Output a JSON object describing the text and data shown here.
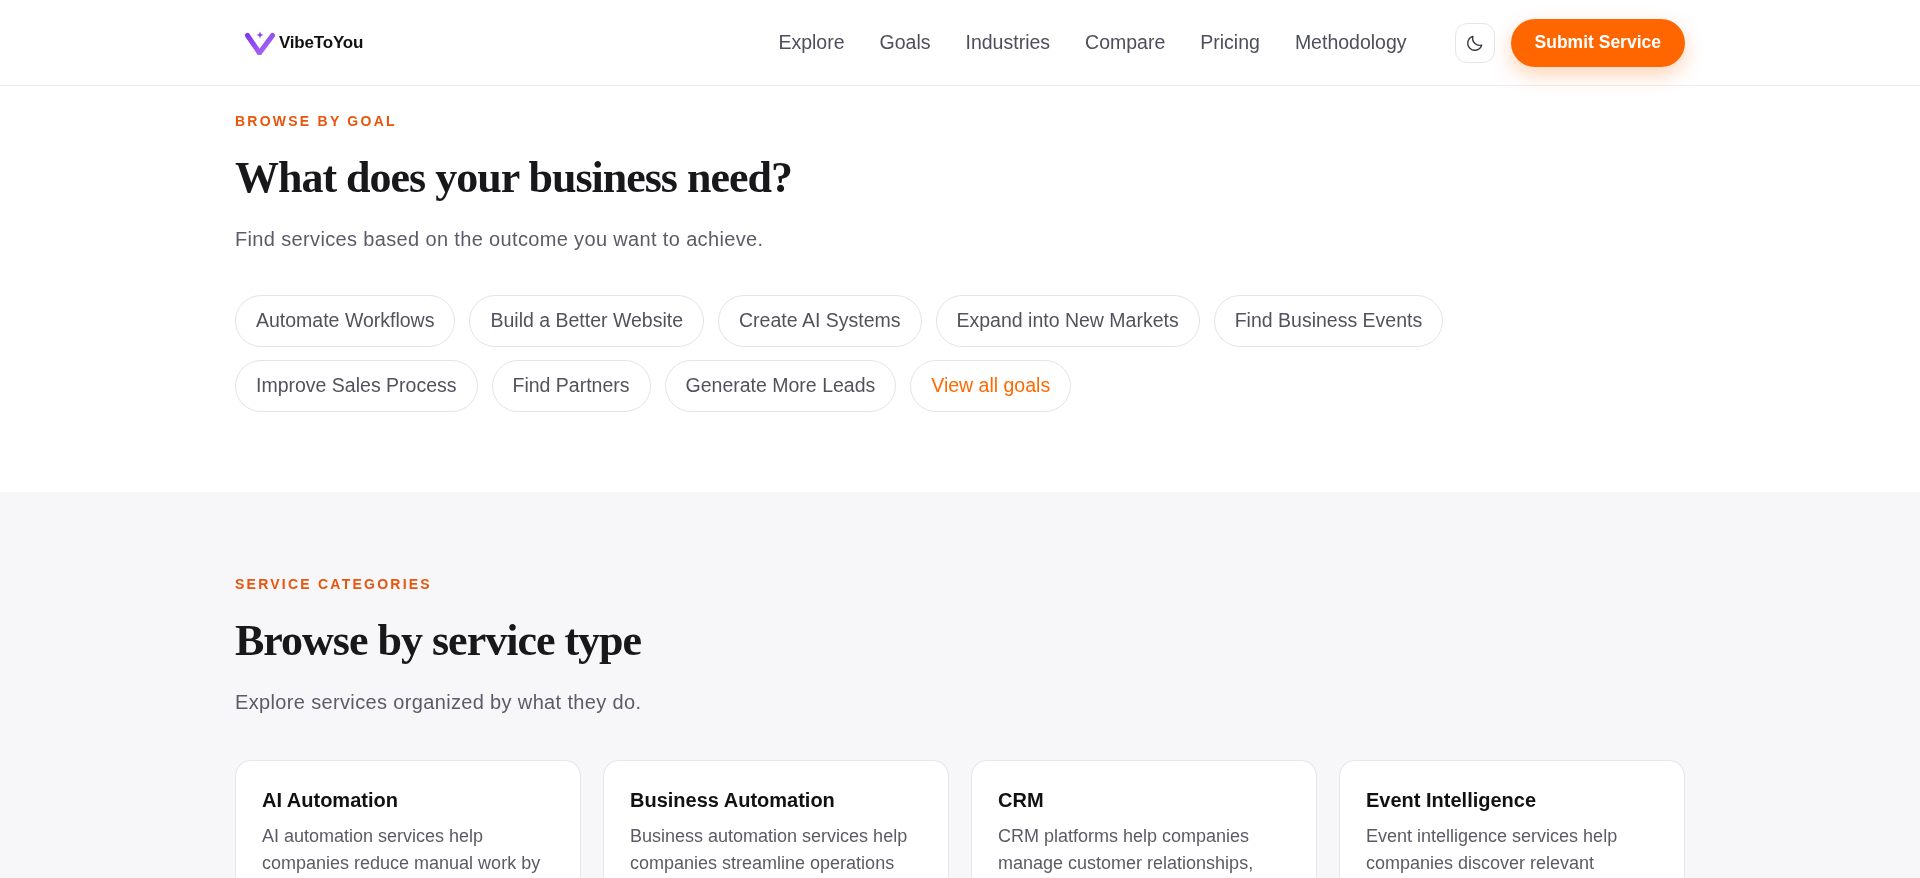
{
  "header": {
    "brand": "VibeToYou",
    "nav": [
      "Explore",
      "Goals",
      "Industries",
      "Compare",
      "Pricing",
      "Methodology"
    ],
    "cta": "Submit Service"
  },
  "goals_section": {
    "eyebrow": "BROWSE BY GOAL",
    "title": "What does your business need?",
    "subtitle": "Find services based on the outcome you want to achieve.",
    "chips": [
      {
        "label": "Automate Workflows",
        "kind": "goal"
      },
      {
        "label": "Build a Better Website",
        "kind": "goal"
      },
      {
        "label": "Create AI Systems",
        "kind": "goal"
      },
      {
        "label": "Expand into New Markets",
        "kind": "goal"
      },
      {
        "label": "Find Business Events",
        "kind": "goal"
      },
      {
        "label": "Improve Sales Process",
        "kind": "goal"
      },
      {
        "label": "Find Partners",
        "kind": "goal"
      },
      {
        "label": "Generate More Leads",
        "kind": "goal"
      },
      {
        "label": "View all goals",
        "kind": "link"
      }
    ]
  },
  "categories_section": {
    "eyebrow": "SERVICE CATEGORIES",
    "title": "Browse by service type",
    "subtitle": "Explore services organized by what they do.",
    "cards": [
      {
        "title": "AI Automation",
        "description": "AI automation services help companies reduce manual work by"
      },
      {
        "title": "Business Automation",
        "description": "Business automation services help companies streamline operations"
      },
      {
        "title": "CRM",
        "description": "CRM platforms help companies manage customer relationships,"
      },
      {
        "title": "Event Intelligence",
        "description": "Event intelligence services help companies discover relevant"
      }
    ]
  }
}
